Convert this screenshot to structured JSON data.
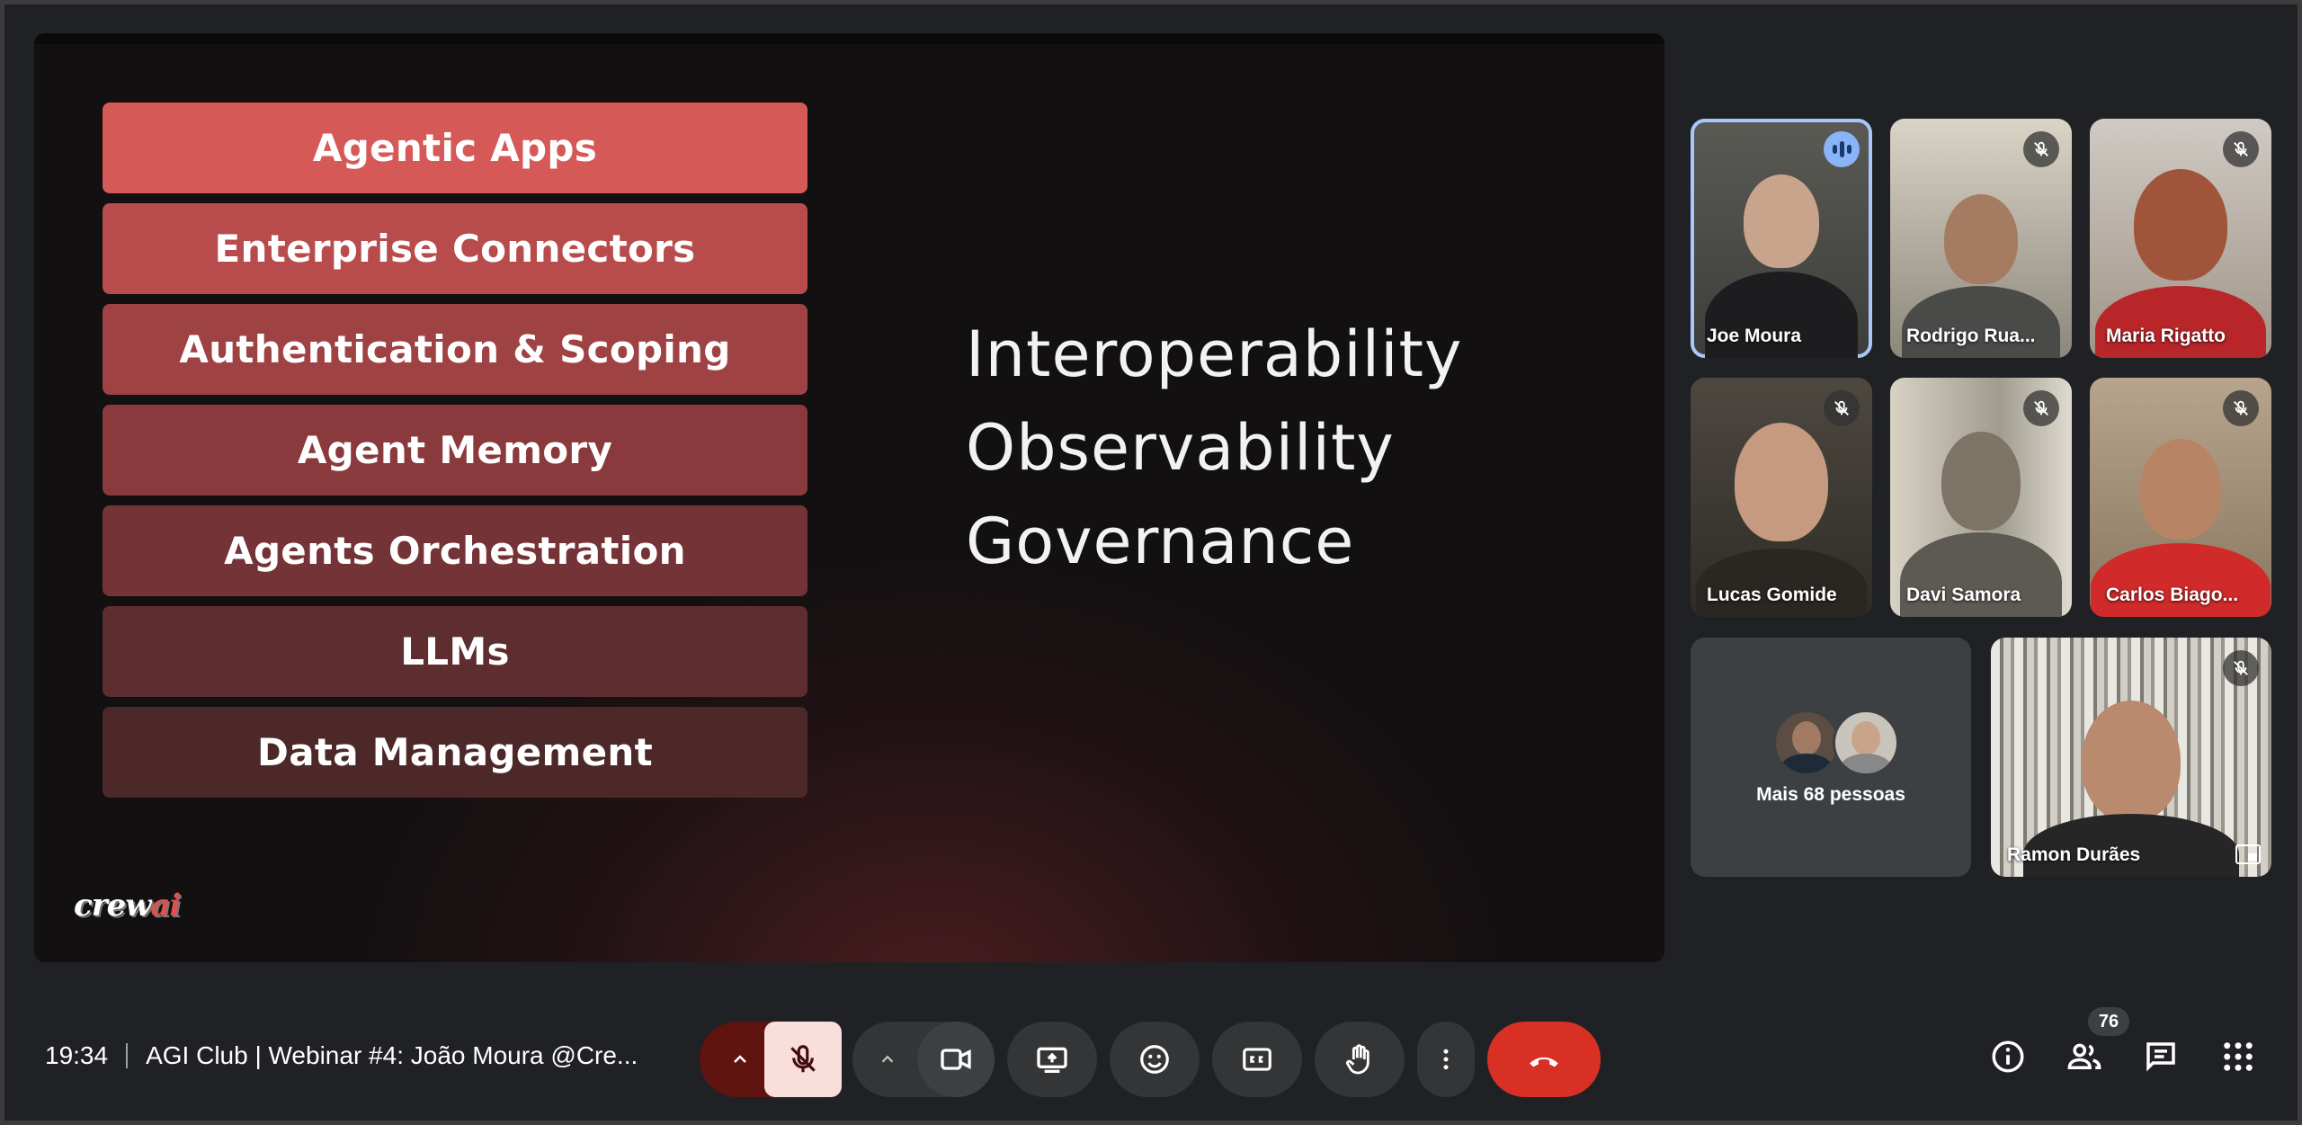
{
  "slide": {
    "stack_layers": [
      "Agentic Apps",
      "Enterprise Connectors",
      "Authentication & Scoping",
      "Agent Memory",
      "Agents Orchestration",
      "LLMs",
      "Data Management"
    ],
    "pillars": [
      "Interoperability",
      "Observability",
      "Governance"
    ],
    "logo_text": "crewai"
  },
  "participants": [
    {
      "name": "Joe Moura",
      "status": "speaking"
    },
    {
      "name": "Rodrigo Rua...",
      "status": "muted"
    },
    {
      "name": "Maria Rigatto",
      "status": "muted"
    },
    {
      "name": "Lucas Gomide",
      "status": "muted"
    },
    {
      "name": "Davi Samora",
      "status": "muted"
    },
    {
      "name": "Carlos Biago...",
      "status": "muted"
    },
    {
      "name": "Ramon Durães",
      "status": "muted"
    }
  ],
  "more_people": {
    "label": "Mais 68 pessoas"
  },
  "meeting": {
    "time": "19:34",
    "title": "AGI Club | Webinar #4: João Moura @Cre..."
  },
  "people_count": "76",
  "colors": {
    "end_call": "#d93025",
    "mic_off_bg": "#f9dedc",
    "mic_chevron_bg": "#601410",
    "speaking": "#8ab4f8",
    "background": "#202124"
  },
  "icons": {
    "mic": "mic-off-icon",
    "camera": "video-camera-icon",
    "present": "present-screen-icon",
    "reactions": "emoji-icon",
    "captions": "closed-captions-icon",
    "hand": "raise-hand-icon",
    "more": "more-vert-icon",
    "end": "call-end-icon",
    "info": "info-icon",
    "people": "people-icon",
    "chat": "chat-icon",
    "activities": "apps-grid-icon"
  }
}
